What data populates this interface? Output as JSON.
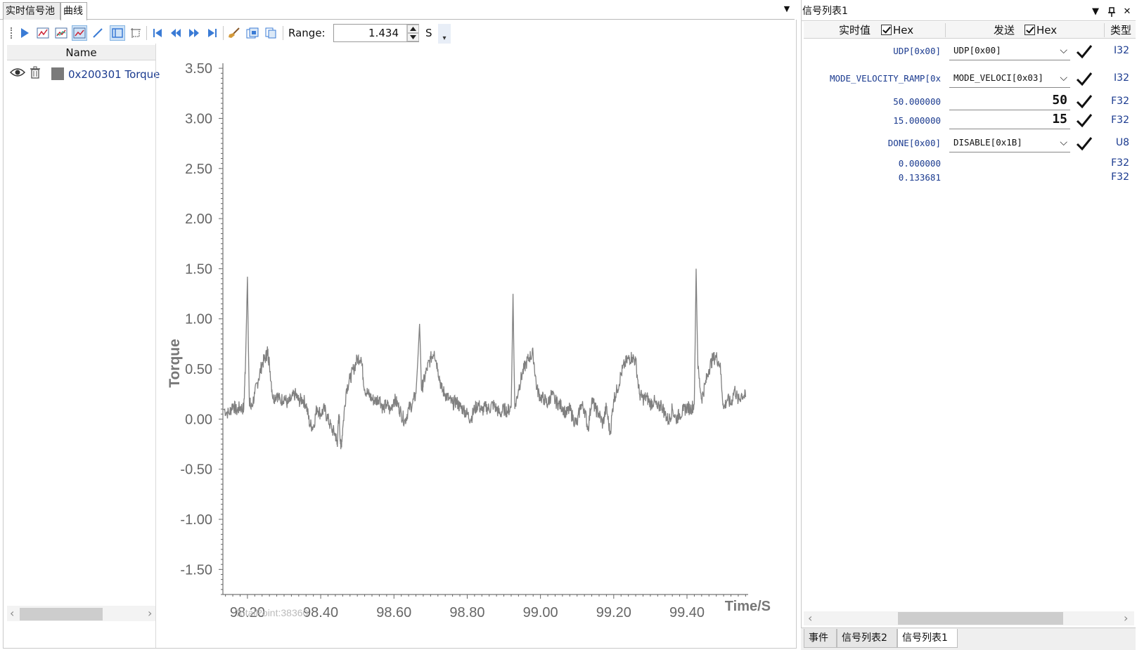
{
  "left_tabs": [
    {
      "label": "实时信号池",
      "active": false
    },
    {
      "label": "曲线",
      "active": true
    }
  ],
  "toolbar": {
    "icons": [
      "play-icon",
      "chart-add-icon",
      "chart-multi-icon",
      "line-tool-icon",
      "panel-toggle-icon",
      "select-region-icon",
      "first-icon",
      "rewind-icon",
      "fast-forward-icon",
      "last-icon",
      "clear-brush-icon",
      "export-icon",
      "copy-icon"
    ],
    "range_label": "Range:",
    "range_value": "1.434",
    "range_unit": "S"
  },
  "signal_list": {
    "header": "Name",
    "items": [
      {
        "name": "0x200301 Torque",
        "color": "#7a7a7a",
        "visible": true
      }
    ]
  },
  "chart_data": {
    "type": "line",
    "ylabel": "Torque",
    "xlabel": "Time/S",
    "ylim": [
      -1.75,
      3.55
    ],
    "xlim": [
      98.133,
      99.567
    ],
    "y_ticks": [
      "3.50",
      "3.00",
      "2.50",
      "2.00",
      "1.50",
      "1.00",
      "0.50",
      "0.00",
      "-0.50",
      "-1.00",
      "-1.50"
    ],
    "y_tick_values": [
      3.5,
      3.0,
      2.5,
      2.0,
      1.5,
      1.0,
      0.5,
      0.0,
      -0.5,
      -1.0,
      -1.5
    ],
    "x_ticks": [
      "98.20",
      "98.40",
      "98.60",
      "98.80",
      "99.00",
      "99.20",
      "99.40"
    ],
    "x_tick_values": [
      98.2,
      98.4,
      98.6,
      98.8,
      99.0,
      99.2,
      99.4
    ],
    "total_points_text": "TotalPoint:38360",
    "line_color": "#808080",
    "grid": false,
    "series": [
      {
        "x": [
          98.135,
          98.15,
          98.16,
          98.17,
          98.18,
          98.19,
          98.195,
          98.2,
          98.205,
          98.21,
          98.22,
          98.23,
          98.24,
          98.25,
          98.255,
          98.26,
          98.27,
          98.28,
          98.29,
          98.3,
          98.31,
          98.32,
          98.33,
          98.34,
          98.35,
          98.36,
          98.37,
          98.38,
          98.39,
          98.4,
          98.41,
          98.42,
          98.43,
          98.44,
          98.445,
          98.45,
          98.455,
          98.46,
          98.47,
          98.48,
          98.49,
          98.5,
          98.51,
          98.52,
          98.53,
          98.54,
          98.55,
          98.56,
          98.57,
          98.58,
          98.59,
          98.6,
          98.61,
          98.62,
          98.63,
          98.64,
          98.65,
          98.66,
          98.67,
          98.675,
          98.68,
          98.69,
          98.7,
          98.71,
          98.72,
          98.73,
          98.74,
          98.75,
          98.76,
          98.77,
          98.78,
          98.79,
          98.8,
          98.81,
          98.82,
          98.83,
          98.84,
          98.85,
          98.86,
          98.87,
          98.88,
          98.89,
          98.9,
          98.91,
          98.92,
          98.925,
          98.93,
          98.94,
          98.95,
          98.96,
          98.97,
          98.98,
          98.99,
          99.0,
          99.01,
          99.02,
          99.03,
          99.04,
          99.05,
          99.06,
          99.07,
          99.08,
          99.09,
          99.1,
          99.11,
          99.12,
          99.13,
          99.14,
          99.15,
          99.16,
          99.17,
          99.18,
          99.19,
          99.2,
          99.21,
          99.22,
          99.23,
          99.24,
          99.25,
          99.26,
          99.27,
          99.28,
          99.29,
          99.3,
          99.31,
          99.32,
          99.33,
          99.34,
          99.35,
          99.36,
          99.37,
          99.38,
          99.39,
          99.4,
          99.41,
          99.42,
          99.425,
          99.43,
          99.44,
          99.45,
          99.46,
          99.47,
          99.48,
          99.49,
          99.5,
          99.51,
          99.52,
          99.53,
          99.54,
          99.55,
          99.56
        ],
        "y": [
          0.1,
          0.05,
          0.15,
          0.08,
          0.12,
          0.1,
          0.6,
          1.42,
          0.2,
          0.1,
          0.25,
          0.4,
          0.55,
          0.62,
          0.68,
          0.55,
          0.2,
          0.25,
          0.18,
          0.22,
          0.15,
          0.2,
          0.25,
          0.18,
          0.2,
          0.15,
          -0.05,
          -0.08,
          0.12,
          0.05,
          0.1,
          0.0,
          -0.1,
          -0.15,
          -0.25,
          0.05,
          -0.3,
          -0.1,
          0.3,
          0.4,
          0.5,
          0.6,
          0.62,
          0.3,
          0.25,
          0.2,
          0.18,
          0.22,
          0.1,
          0.15,
          0.08,
          0.2,
          0.15,
          0.05,
          -0.02,
          0.1,
          0.15,
          0.25,
          0.95,
          0.3,
          0.35,
          0.5,
          0.6,
          0.68,
          0.5,
          0.3,
          0.25,
          0.2,
          0.15,
          0.18,
          0.12,
          0.1,
          0.05,
          0.0,
          0.1,
          0.15,
          0.08,
          0.12,
          0.1,
          0.15,
          0.1,
          0.05,
          0.1,
          0.08,
          0.12,
          1.25,
          0.1,
          0.3,
          0.45,
          0.55,
          0.62,
          0.65,
          0.3,
          0.22,
          0.2,
          0.15,
          0.25,
          0.18,
          0.15,
          0.12,
          0.05,
          0.1,
          0.0,
          -0.05,
          0.15,
          0.1,
          -0.1,
          0.2,
          0.1,
          0.05,
          -0.05,
          0.12,
          -0.15,
          0.2,
          0.3,
          0.45,
          0.55,
          0.6,
          0.62,
          0.58,
          0.25,
          0.2,
          0.22,
          0.15,
          0.18,
          0.1,
          0.15,
          0.05,
          -0.02,
          0.1,
          0.0,
          0.05,
          0.08,
          0.12,
          0.1,
          0.15,
          1.5,
          0.5,
          0.2,
          0.35,
          0.5,
          0.6,
          0.62,
          0.55,
          0.1,
          0.2,
          0.15,
          0.3,
          0.18,
          0.25,
          0.22
        ]
      }
    ]
  },
  "right_panel": {
    "title": "信号列表1",
    "headers": {
      "realtime": "实时值",
      "hex1": "Hex",
      "send": "发送",
      "hex2": "Hex",
      "type": "类型"
    },
    "rows": [
      {
        "value": "UDP[0x00]",
        "send": "UDP[0x00]",
        "send_kind": "dropdown",
        "confirm": true,
        "type": "I32"
      },
      {
        "value": "MODE_VELOCITY_RAMP[0x",
        "send": "MODE_VELOCI[0x03]",
        "send_kind": "dropdown",
        "confirm": true,
        "type": "I32"
      },
      {
        "value": "50.000000",
        "send": "50",
        "send_kind": "input",
        "confirm": true,
        "type": "F32"
      },
      {
        "value": "15.000000",
        "send": "15",
        "send_kind": "input",
        "confirm": true,
        "type": "F32"
      },
      {
        "value": "DONE[0x00]",
        "send": "DISABLE[0x1B]",
        "send_kind": "dropdown",
        "confirm": true,
        "type": "U8"
      },
      {
        "value": "0.000000",
        "send": "",
        "send_kind": "none",
        "confirm": false,
        "type": "F32"
      },
      {
        "value": "0.133681",
        "send": "",
        "send_kind": "none",
        "confirm": false,
        "type": "F32"
      }
    ],
    "bottom_tabs": [
      {
        "label": "事件",
        "active": false
      },
      {
        "label": "信号列表2",
        "active": false
      },
      {
        "label": "信号列表1",
        "active": true
      }
    ]
  }
}
